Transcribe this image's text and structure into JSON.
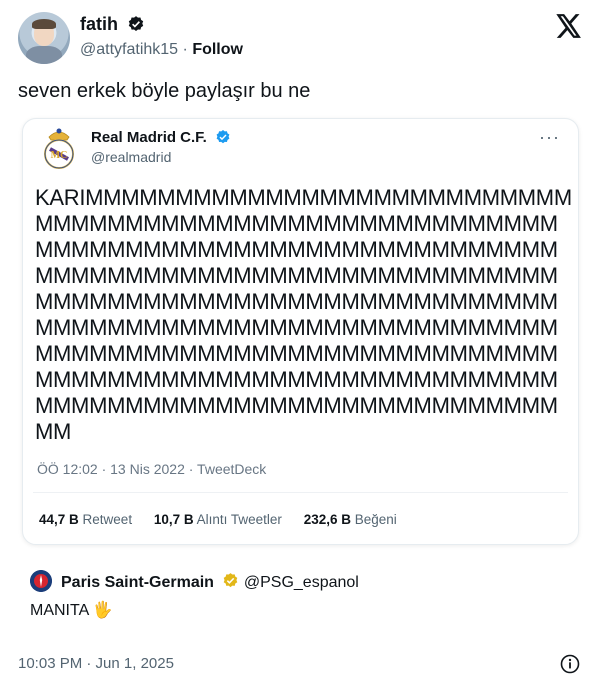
{
  "author": {
    "name": "fatih",
    "handle": "@attyfatihk15",
    "separator": "·",
    "follow_label": "Follow"
  },
  "tweet": {
    "text": "seven erkek böyle paylaşır bu ne"
  },
  "quoted": {
    "name": "Real Madrid C.F.",
    "handle": "@realmadrid",
    "more": "···",
    "text": "KARIMMMMMMMMMMMMMMMMMMMMMMMMMMMMMMMMMMMMMMMMMMMMMMMMMMMMMMMMMMMMMMMMMMMMMMMMMMMMMMMMMMMMMMMMMMMMMMMMMMMMMMMMMMMMMMMMMMMMMMMMMMMMMMMMMMMMMMMMMMMMMMMMMMMMMMMMMMMMMMMMMMMMMMMMMMMMMMMMMMMMMMMMMMMMMMMMMMMMMMMMMMMMMMMMMMMMMMMMMMMMMMMMMMMMMMMMMMMMMMMMMMMMMMMMMMMMMMMMMMMMM",
    "meta": "ÖÖ 12:02 · 13 Nis 2022 · TweetDeck",
    "stats": [
      {
        "value": "44,7 B",
        "label": "Retweet"
      },
      {
        "value": "10,7 B",
        "label": "Alıntı Tweetler"
      },
      {
        "value": "232,6 B",
        "label": "Beğeni"
      }
    ]
  },
  "reply": {
    "name": "Paris Saint-Germain",
    "handle": "@PSG_espanol",
    "text": "MANITA 🖐"
  },
  "footer": {
    "timestamp": "10:03 PM · Jun 1, 2025"
  },
  "icons": {
    "verified": "verified-badge-icon",
    "x_logo": "x-logo-icon",
    "info": "info-icon"
  },
  "colors": {
    "verified_blue": "#1d9bf0",
    "gold_badge": "#e2b719",
    "psg_navy": "#1b3d7a"
  }
}
